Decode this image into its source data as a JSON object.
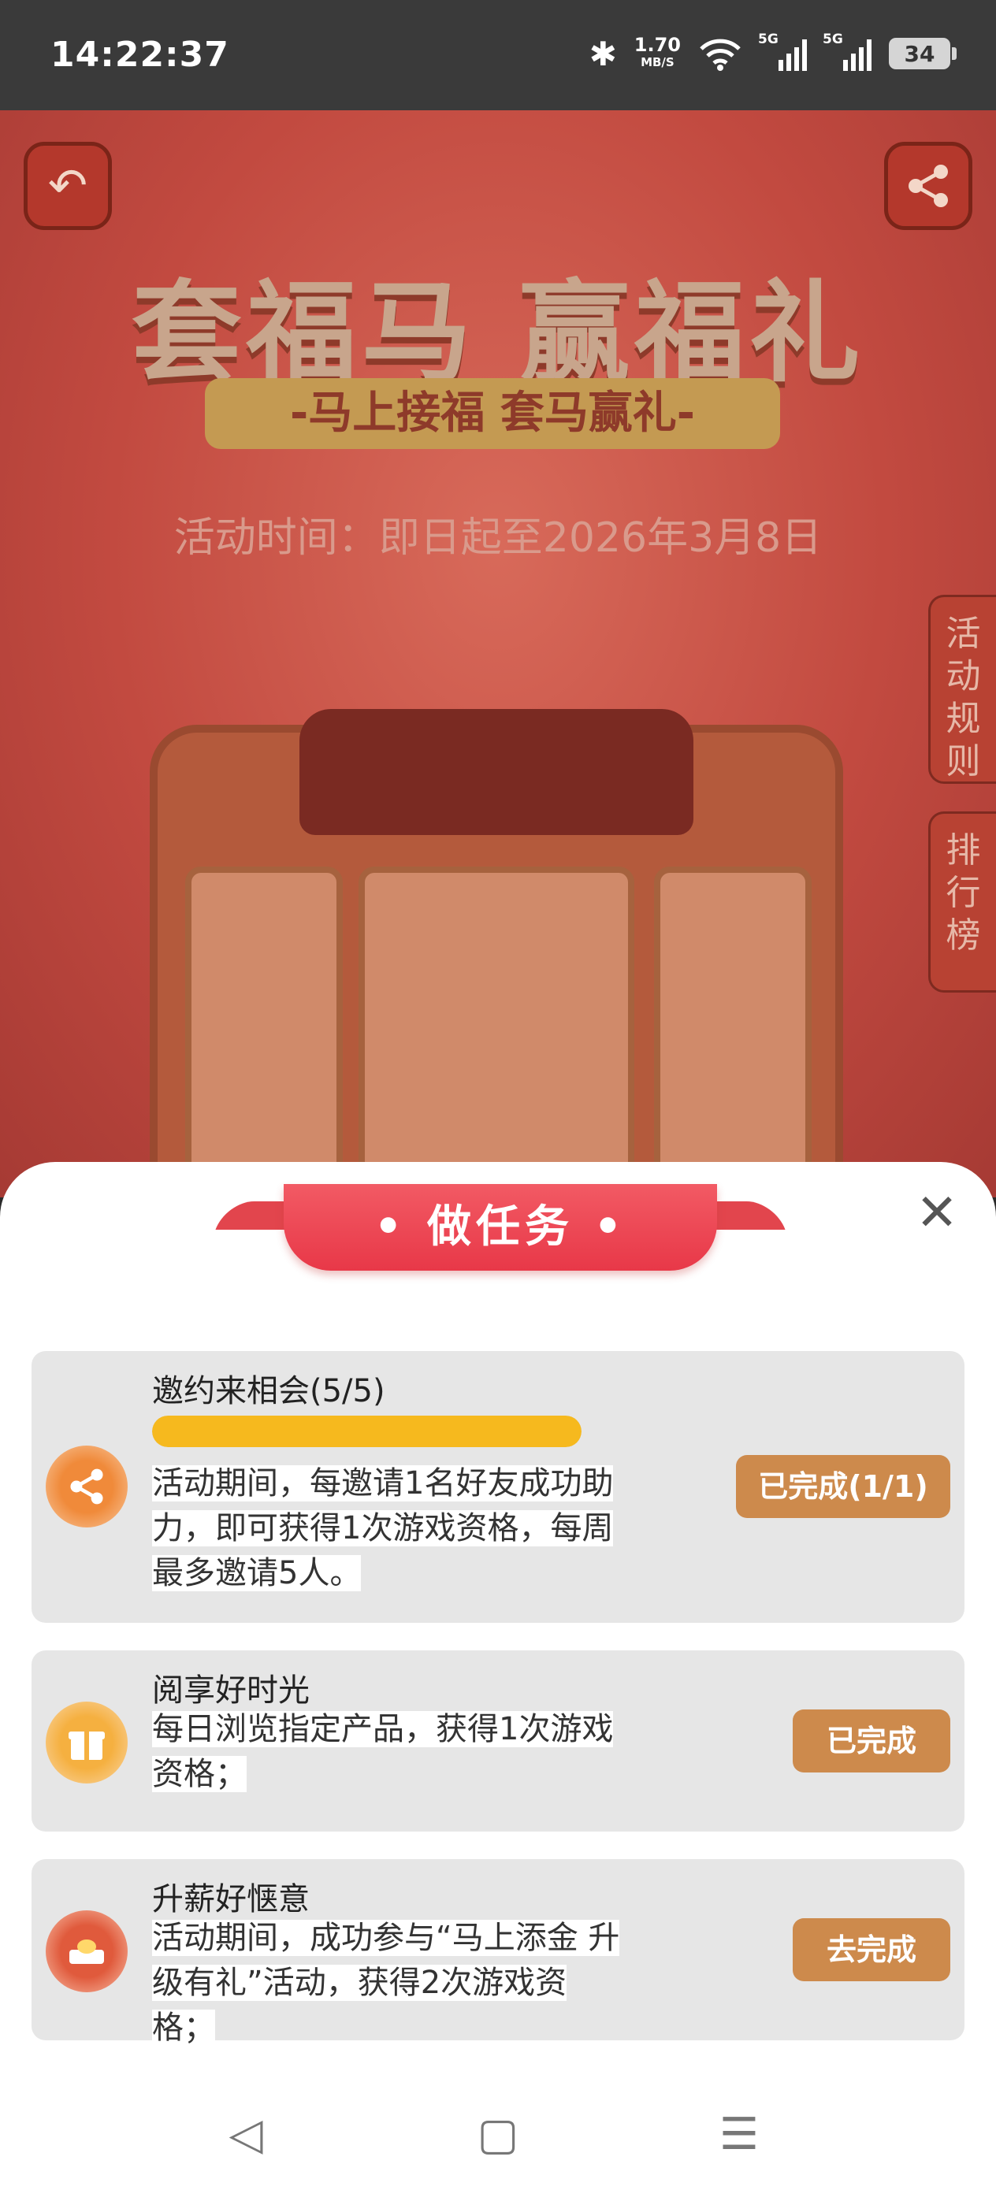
{
  "status_bar": {
    "time": "14:22:37",
    "network_speed_value": "1.70",
    "network_speed_unit": "MB/S",
    "signal_1_label": "5G",
    "signal_2_label": "5G",
    "battery": "34",
    "icons": [
      "bluetooth-icon",
      "wifi-icon",
      "signal-icon",
      "signal-icon",
      "battery-icon"
    ]
  },
  "background": {
    "title": "套福马 赢福礼",
    "subtitle": "-马上接福 套马赢礼-",
    "activity_time": "活动时间：即日起至2026年3月8日",
    "rules_tab": "活动规则",
    "rank_tab": "排行榜",
    "back_icon": "back-arrow-icon",
    "share_icon": "share-icon"
  },
  "modal": {
    "title": "• 做任务 •",
    "close_icon": "close-icon",
    "tasks": [
      {
        "title": "邀约来相会(5/5)",
        "progress": 1.0,
        "description": "活动期间，每邀请1名好友成功助力，即可获得1次游戏资格，每周最多邀请5人。",
        "button": "已完成(1/1)",
        "icon": "share-icon"
      },
      {
        "title": "阅享好时光",
        "description": "每日浏览指定产品，获得1次游戏资格；",
        "button": "已完成",
        "icon": "gift-box-icon"
      },
      {
        "title": "升薪好惬意",
        "description": "活动期间，成功参与“马上添金 升级有礼”活动，获得2次游戏资格；",
        "button": "去完成",
        "icon": "gold-ingot-icon"
      }
    ]
  },
  "nav_bar": {
    "back_icon": "nav-back-icon",
    "home_icon": "nav-home-icon",
    "menu_icon": "nav-menu-icon"
  },
  "colors": {
    "accent_red": "#e83848",
    "button_brown": "#cd8a4c",
    "progress_yellow": "#f6b91e",
    "card_bg": "#e6e6e6"
  }
}
